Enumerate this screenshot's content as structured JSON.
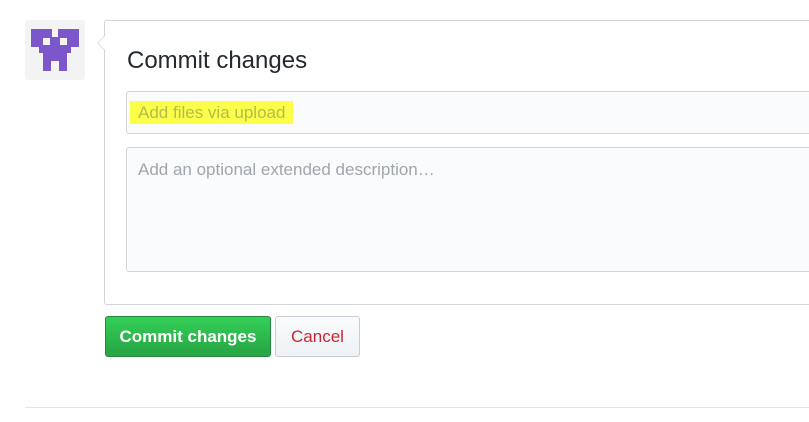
{
  "commit_form": {
    "title": "Commit changes",
    "summary_placeholder": "Add files via upload",
    "description_placeholder": "Add an optional extended description…"
  },
  "actions": {
    "commit_label": "Commit changes",
    "cancel_label": "Cancel"
  },
  "colors": {
    "avatar": "#7b57c9",
    "commit_button": "#28a745",
    "cancel_text": "#cb2431",
    "highlight": "#fbff4a"
  }
}
